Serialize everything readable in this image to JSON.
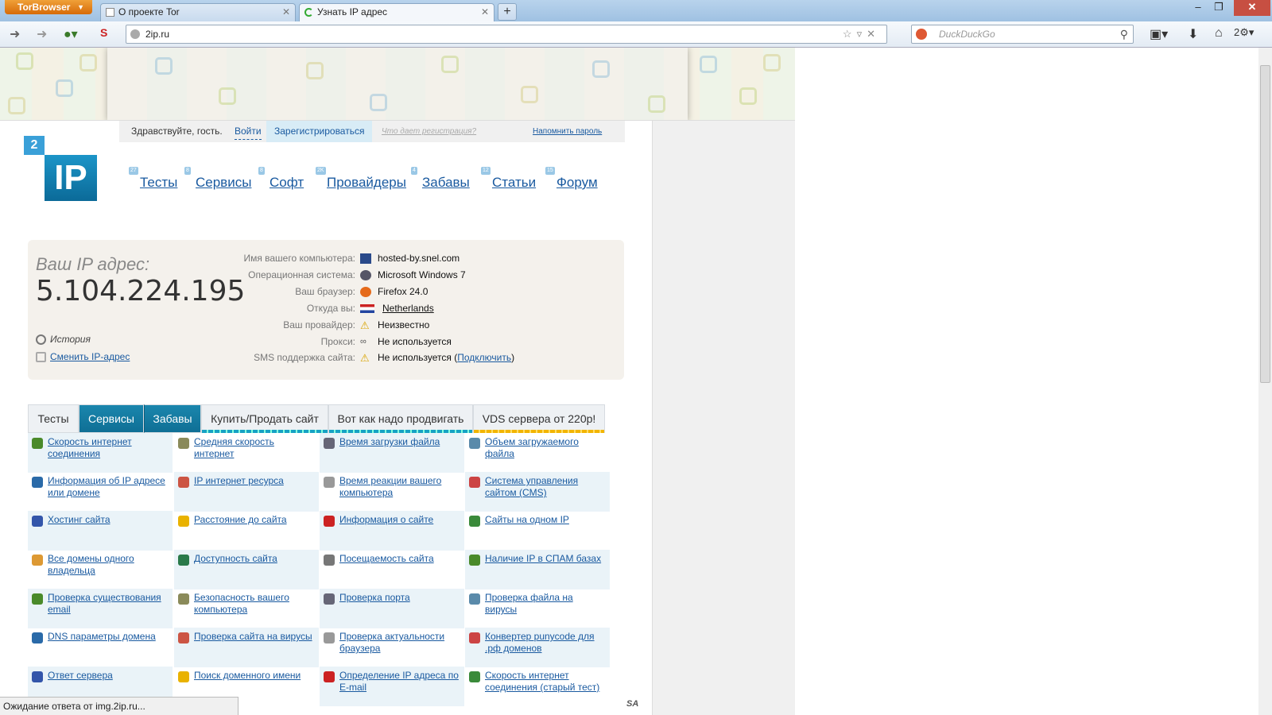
{
  "browser": {
    "app_button": "TorBrowser",
    "tabs": [
      {
        "title": "О проекте Tor",
        "active": false
      },
      {
        "title": "Узнать IP адрес",
        "active": true
      }
    ],
    "new_tab": "+",
    "url": "2ip.ru",
    "search_placeholder": "DuckDuckGo",
    "status": "Ожидание ответа от img.2ip.ru..."
  },
  "login": {
    "greeting": "Здравствуйте, гость.",
    "login_link": "Войти",
    "register_link": "Зарегистрироваться",
    "why_register": "Что дает регистрация?",
    "remind_password": "Напомнить пароль"
  },
  "logo": {
    "top": "2",
    "main": "IP"
  },
  "menu": [
    {
      "label": "Тесты",
      "count": "27"
    },
    {
      "label": "Сервисы",
      "count": "8"
    },
    {
      "label": "Софт",
      "count": "8"
    },
    {
      "label": "Провайдеры",
      "count": "2K"
    },
    {
      "label": "Забавы",
      "count": "4"
    },
    {
      "label": "Статьи",
      "count": "12"
    },
    {
      "label": "Форум",
      "count": "15"
    }
  ],
  "ip_panel": {
    "label": "Ваш IP адрес:",
    "ip": "5.104.224.195",
    "history": "История",
    "change_ip": "Сменить IP-адрес",
    "info": [
      {
        "key": "Имя вашего компьютера:",
        "value": "hosted-by.snel.com",
        "link": false
      },
      {
        "key": "Операционная система:",
        "value": "Microsoft Windows 7",
        "link": false
      },
      {
        "key": "Ваш браузер:",
        "value": "Firefox 24.0",
        "link": false
      },
      {
        "key": "Откуда вы:",
        "value": "Netherlands",
        "link": true
      },
      {
        "key": "Ваш провайдер:",
        "value": "Неизвестно",
        "link": false
      },
      {
        "key": "Прокси:",
        "value": "Не используется",
        "link": false
      },
      {
        "key": "SMS поддержка сайта:",
        "value": "Не используется (",
        "link": false,
        "extra_link": "Подключить",
        "extra_tail": ")"
      }
    ]
  },
  "section_tabs": [
    {
      "label": "Тесты",
      "active": false
    },
    {
      "label": "Сервисы",
      "active": true
    },
    {
      "label": "Забавы",
      "active": true
    },
    {
      "label": "Купить/Продать сайт",
      "active": false
    },
    {
      "label": "Вот как надо продвигать",
      "active": false
    },
    {
      "label": "VDS сервера от 220р!",
      "active": false
    }
  ],
  "services": [
    [
      "Скорость интернет соединения",
      "Средняя скорость интернет",
      "Время загрузки файла",
      "Объем загружаемого файла"
    ],
    [
      "Информация об IP адресе или домене",
      "IP интернет ресурса",
      "Время реакции вашего компьютера",
      "Система управления сайтом (CMS)"
    ],
    [
      "Хостинг сайта",
      "Расстояние до сайта",
      "Информация о сайте",
      "Сайты на одном IP"
    ],
    [
      "Все домены одного владельца",
      "Доступность сайта",
      "Посещаемость сайта",
      "Наличие IP в СПАМ базах"
    ],
    [
      "Проверка существования email",
      "Безопасность вашего компьютера",
      "Проверка порта",
      "Проверка файла на вирусы"
    ],
    [
      "DNS параметры домена",
      "Проверка сайта на вирусы",
      "Проверка актуальности браузера",
      "Конвертер punycode для .рф доменов"
    ],
    [
      "Ответ сервера",
      "Поиск доменного имени",
      "Определение IP адреса по E-mail",
      "Скорость интернет соединения (старый тест)"
    ]
  ],
  "footer_mark": "SA",
  "colors": {
    "accent": "#0f6f95",
    "link": "#1a5aa0",
    "tor_orange": "#e07a10"
  }
}
